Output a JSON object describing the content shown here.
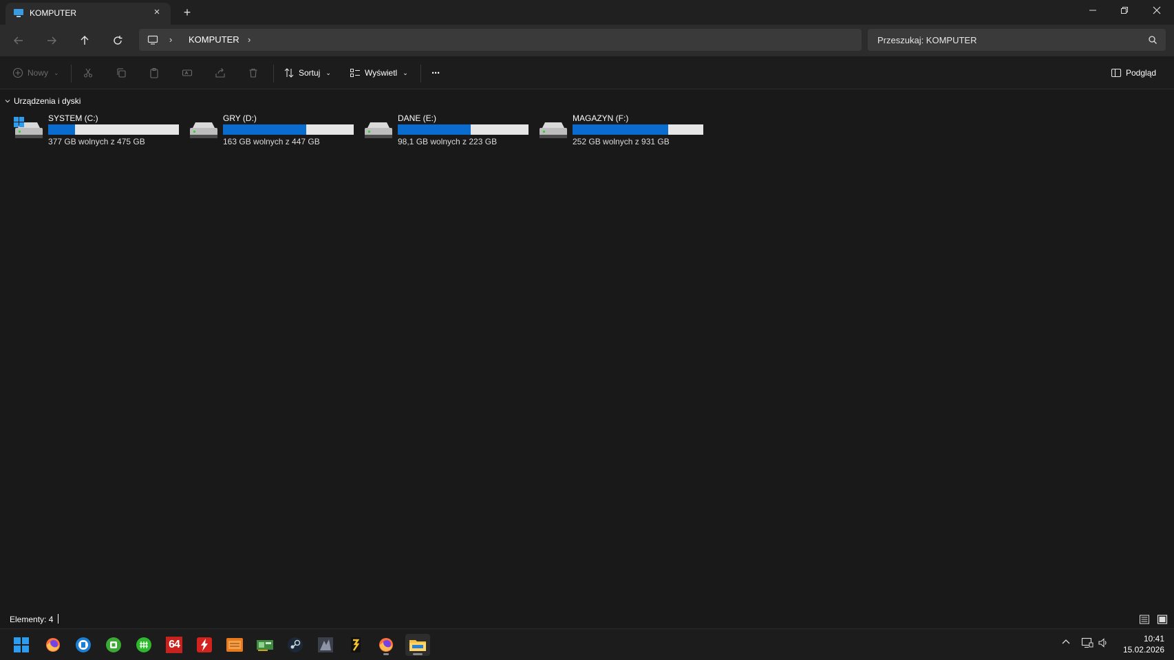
{
  "window": {
    "tab_title": "KOMPUTER",
    "tab_close": "×",
    "new_tab": "+"
  },
  "nav": {
    "breadcrumb": "KOMPUTER",
    "separator": "›",
    "search_placeholder": "Przeszukaj: KOMPUTER"
  },
  "toolbar": {
    "new_label": "Nowy",
    "sort_label": "Sortuj",
    "view_label": "Wyświetl",
    "more_label": "···",
    "preview_label": "Podgląd"
  },
  "content": {
    "group_title": "Urządzenia i dyski",
    "drives": [
      {
        "name": "SYSTEM (C:)",
        "free_text": "377 GB wolnych z 475 GB",
        "used_fraction": 0.206
      },
      {
        "name": "GRY (D:)",
        "free_text": "163 GB wolnych z 447 GB",
        "used_fraction": 0.635
      },
      {
        "name": "DANE (E:)",
        "free_text": "98,1 GB wolnych z 223 GB",
        "used_fraction": 0.56
      },
      {
        "name": "MAGAZYN (F:)",
        "free_text": "252 GB wolnych z 931 GB",
        "used_fraction": 0.729
      }
    ]
  },
  "status": {
    "item_count": "Elementy: 4"
  },
  "taskbar": {
    "clock_time": "10:41",
    "clock_date": "15.02.2026",
    "aida_label": "64"
  },
  "colors": {
    "accent": "#0a6ccf",
    "background": "#191919",
    "bar_track": "#e6e6e6"
  }
}
